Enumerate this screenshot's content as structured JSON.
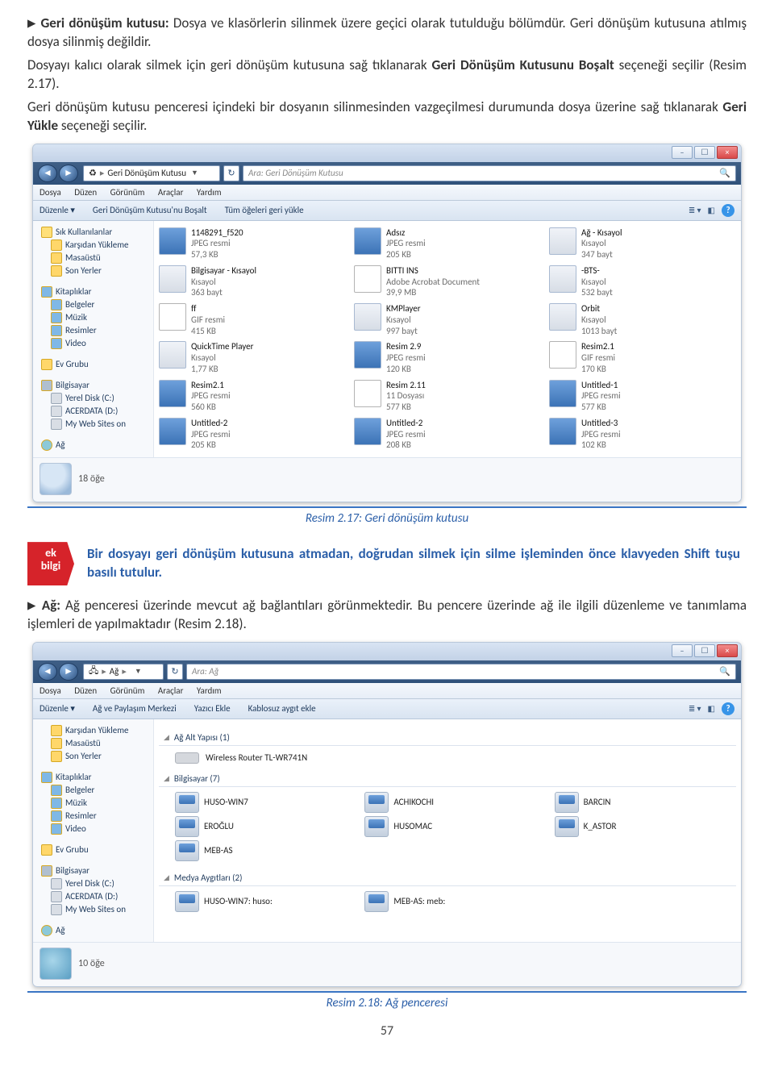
{
  "intro": {
    "p1a": "Geri dönüşüm kutusu:",
    "p1b": " Dosya ve klasörlerin silinmek üzere geçici olarak tutulduğu bölümdür. Geri dönüşüm kutusuna atılmış dosya silinmiş değildir.",
    "p2a": "Dosyayı kalıcı olarak silmek için geri dönüşüm kutusuna sağ tıklanarak ",
    "p2b": "Geri Dönüşüm Kutusunu Boşalt",
    "p2c": " seçeneği seçilir (Resim 2.17).",
    "p3a": "Geri dönüşüm kutusu penceresi içindeki bir dosyanın silinmesinden vazgeçilmesi durumunda dosya üzerine sağ tıklanarak ",
    "p3b": "Geri Yükle",
    "p3c": " seçeneği seçilir."
  },
  "win1": {
    "breadcrumb": "Geri Dönüşüm Kutusu",
    "searchPlaceholder": "Ara: Geri Dönüşüm Kutusu",
    "menus": [
      "Dosya",
      "Düzen",
      "Görünüm",
      "Araçlar",
      "Yardım"
    ],
    "toolbar": [
      "Düzenle ▾",
      "Geri Dönüşüm Kutusu'nu Boşalt",
      "Tüm öğeleri geri yükle"
    ],
    "nav": {
      "fav": "Sık Kullanılanlar",
      "favItems": [
        "Karşıdan Yükleme",
        "Masaüstü",
        "Son Yerler"
      ],
      "lib": "Kitaplıklar",
      "libItems": [
        "Belgeler",
        "Müzik",
        "Resimler",
        "Video"
      ],
      "home": "Ev Grubu",
      "pc": "Bilgisayar",
      "pcItems": [
        "Yerel Disk (C:)",
        "ACERDATA (D:)",
        "My Web Sites on"
      ],
      "net": "Ağ"
    },
    "files": [
      {
        "n": "1148291_f520",
        "t": "JPEG resmi",
        "s": "57,3 KB",
        "k": "jpg"
      },
      {
        "n": "Adsız",
        "t": "JPEG resmi",
        "s": "205 KB",
        "k": "jpg"
      },
      {
        "n": "Ağ - Kısayol",
        "t": "Kısayol",
        "s": "347 bayt",
        "k": "lnk"
      },
      {
        "n": "Bilgisayar - Kısayol",
        "t": "Kısayol",
        "s": "363 bayt",
        "k": "lnk"
      },
      {
        "n": "BITTI INS",
        "t": "Adobe Acrobat Document",
        "s": "39,9 MB",
        "k": "gif"
      },
      {
        "n": "-BTS-",
        "t": "Kısayol",
        "s": "532 bayt",
        "k": "lnk"
      },
      {
        "n": "ff",
        "t": "GIF resmi",
        "s": "415 KB",
        "k": "gif"
      },
      {
        "n": "KMPlayer",
        "t": "Kısayol",
        "s": "997 bayt",
        "k": "lnk"
      },
      {
        "n": "Orbit",
        "t": "Kısayol",
        "s": "1013 bayt",
        "k": "lnk"
      },
      {
        "n": "QuickTime Player",
        "t": "Kısayol",
        "s": "1,77 KB",
        "k": "lnk"
      },
      {
        "n": "Resim 2.9",
        "t": "JPEG resmi",
        "s": "120 KB",
        "k": "jpg"
      },
      {
        "n": "Resim2.1",
        "t": "GIF resmi",
        "s": "170 KB",
        "k": "gif"
      },
      {
        "n": "Resim2.1",
        "t": "JPEG resmi",
        "s": "560 KB",
        "k": "jpg"
      },
      {
        "n": "Resim 2.11",
        "t": "11 Dosyası",
        "s": "577 KB",
        "k": "gif"
      },
      {
        "n": "Untitled-1",
        "t": "JPEG resmi",
        "s": "577 KB",
        "k": "jpg"
      },
      {
        "n": "Untitled-2",
        "t": "JPEG resmi",
        "s": "205 KB",
        "k": "jpg"
      },
      {
        "n": "Untitled-2",
        "t": "JPEG resmi",
        "s": "208 KB",
        "k": "jpg"
      },
      {
        "n": "Untitled-3",
        "t": "JPEG resmi",
        "s": "102 KB",
        "k": "jpg"
      }
    ],
    "status": "18 öğe",
    "caption": "Resim 2.17: Geri dönüşüm kutusu"
  },
  "ekbilgi": {
    "tag1": "ek",
    "tag2": "bilgi",
    "text": "Bir dosyayı geri dönüşüm kutusuna atmadan, doğrudan silmek için silme işleminden önce klavyeden Shift tuşu basılı tutulur."
  },
  "mid": {
    "p1a": "Ağ:",
    "p1b": " Ağ penceresi üzerinde mevcut ağ bağlantıları görünmektedir. Bu pencere üzerinde ağ ile ilgili düzenleme ve tanımlama işlemleri de yapılmaktadır (Resim 2.18)."
  },
  "win2": {
    "breadcrumb": "Ağ",
    "searchPlaceholder": "Ara: Ağ",
    "menus": [
      "Dosya",
      "Düzen",
      "Görünüm",
      "Araçlar",
      "Yardım"
    ],
    "toolbar": [
      "Düzenle ▾",
      "Ağ ve Paylaşım Merkezi",
      "Yazıcı Ekle",
      "Kablosuz aygıt ekle"
    ],
    "nav": {
      "favItems": [
        "Karşıdan Yükleme",
        "Masaüstü",
        "Son Yerler"
      ],
      "lib": "Kitaplıklar",
      "libItems": [
        "Belgeler",
        "Müzik",
        "Resimler",
        "Video"
      ],
      "home": "Ev Grubu",
      "pc": "Bilgisayar",
      "pcItems": [
        "Yerel Disk (C:)",
        "ACERDATA (D:)",
        "My Web Sites on"
      ],
      "net": "Ağ"
    },
    "g1": {
      "title": "Ağ Alt Yapısı (1)",
      "item": "Wireless Router TL-WR741N"
    },
    "g2": {
      "title": "Bilgisayar (7)",
      "items": [
        "HUSO-WIN7",
        "ACHIKOCHI",
        "BARCIN",
        "EROĞLU",
        "HUSOMAC",
        "K_ASTOR",
        "MEB-AS"
      ]
    },
    "g3": {
      "title": "Medya Aygıtları (2)",
      "items": [
        "HUSO-WIN7: huso:",
        "MEB-AS: meb:"
      ]
    },
    "status": "10 öğe",
    "caption": "Resim 2.18: Ağ penceresi"
  },
  "pagenum": "57"
}
